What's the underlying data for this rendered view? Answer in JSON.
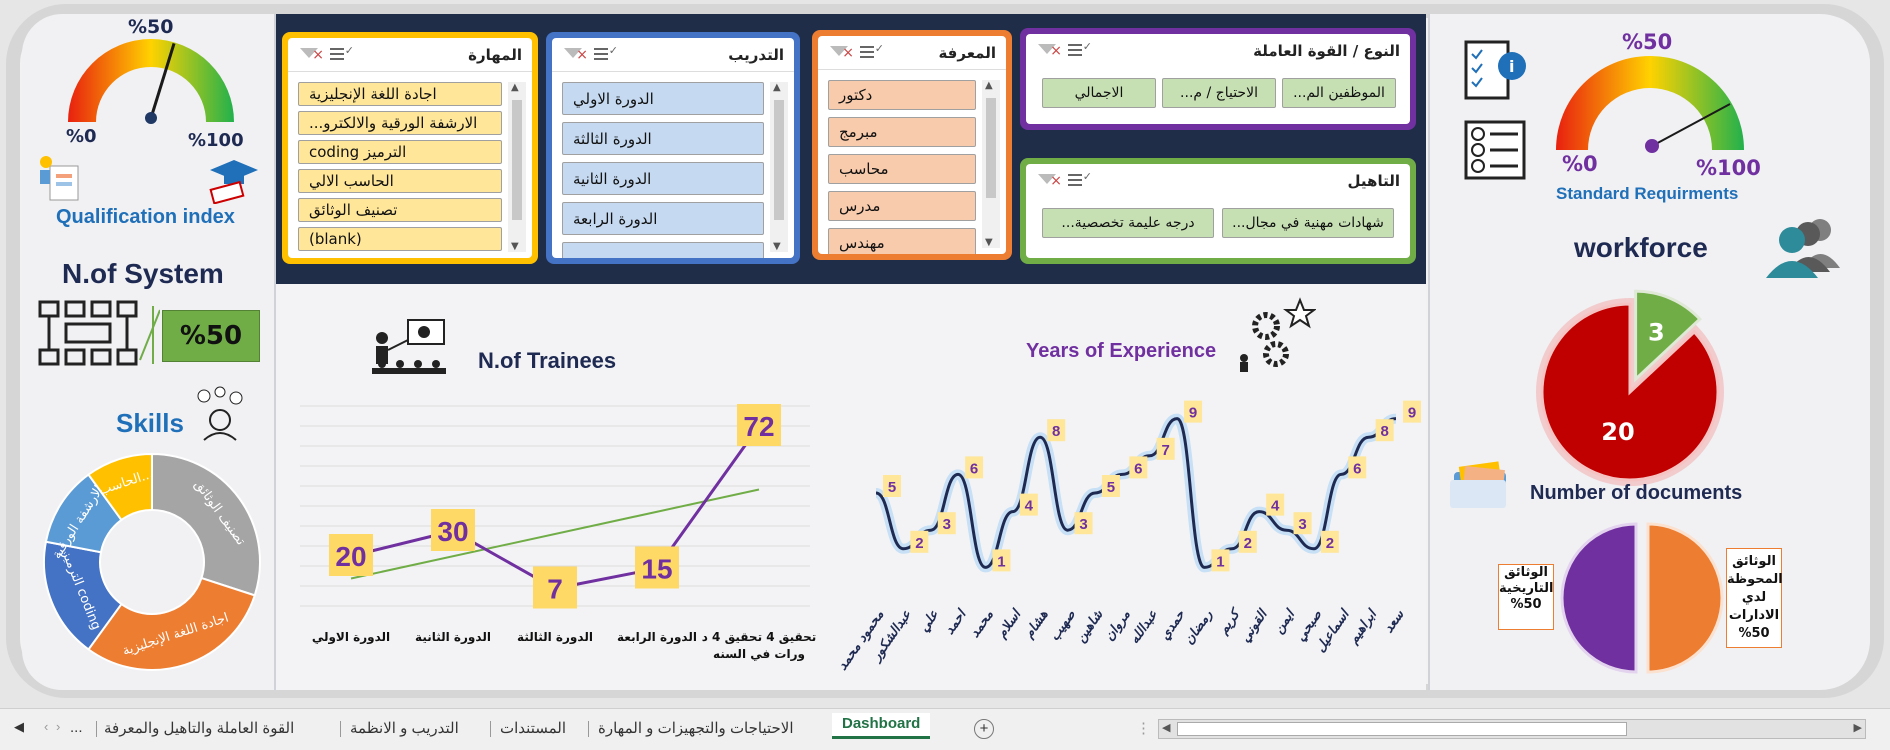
{
  "gauges": {
    "qualification": {
      "top_label": "%50",
      "min_label": "%0",
      "max_label": "%100",
      "value_pct": 50,
      "title": "Qualification index"
    },
    "standard": {
      "top_label": "%50",
      "min_label": "%0",
      "max_label": "%100",
      "value_pct": 70,
      "title": "Standard Requirments"
    }
  },
  "system": {
    "title": "N.of System",
    "value": "%50"
  },
  "skills": {
    "title": "Skills",
    "segments": [
      {
        "label": "تصنيف الوثائق",
        "value": 30,
        "color": "#a5a5a5"
      },
      {
        "label": "اجادة اللغة الإنجليزية",
        "value": 30,
        "color": "#ed7d31"
      },
      {
        "label": "الترميز coding",
        "value": 18,
        "color": "#4472c4"
      },
      {
        "label": "الارشفة الورقية...",
        "value": 12,
        "color": "#5b9bd5"
      },
      {
        "label": "الحاسب...",
        "value": 10,
        "color": "#ffc000"
      }
    ]
  },
  "slicers": {
    "skill": {
      "title": "المهارة",
      "items": [
        "اجادة اللغة الإنجليزية",
        "الارشفة الورقية والالكترو...",
        "coding الترميز",
        "الحاسب الالي",
        "تصنيف الوثائق",
        "(blank)"
      ]
    },
    "training": {
      "title": "التدريب",
      "items": [
        "الدورة الاولي",
        "الدورة الثالثة",
        "الدورة الثانية",
        "الدورة الرابعة",
        ""
      ]
    },
    "knowledge": {
      "title": "المعرفة",
      "items": [
        "دكتور",
        "مبرمج",
        "محاسب",
        "مدرس",
        "مهندس"
      ]
    },
    "workforce_type": {
      "title": "النوع / القوة العاملة",
      "items": [
        "الموظفين الم...",
        "الاحتياج / م...",
        "الاجمالي"
      ]
    },
    "qualification": {
      "title": "التاهيل",
      "items": [
        "شهادات مهنية في مجال...",
        "درجه عليمة تخصصية..."
      ]
    }
  },
  "trainees_chart": {
    "title": "N.of Trainees",
    "chart_data": {
      "type": "line",
      "categories": [
        "الدورة الاولي",
        "الدورة الثانية",
        "الدورة الثالثة",
        "الدورة الرابعة",
        "تحقيق 4 تحقيق 4 دورات في السنه"
      ],
      "series": [
        {
          "values": [
            20,
            30,
            7,
            15,
            72
          ]
        }
      ],
      "trendline": true,
      "ylim": [
        0,
        80
      ]
    }
  },
  "experience_chart": {
    "title": "Years of Experience",
    "chart_data": {
      "type": "line",
      "categories": [
        "محمود محمد",
        "عبدالشكور",
        "علي",
        "احمد",
        "محمد",
        "اسلام",
        "هشام",
        "صهيب",
        "شاهين",
        "مروان",
        "عبدالله",
        "حمدي",
        "رمضان",
        "كريم",
        "القوني",
        "ايمن",
        "صبحي",
        "اسماعيل",
        "ابراهيم",
        "سعد"
      ],
      "series": [
        {
          "values": [
            5,
            2,
            3,
            6,
            1,
            4,
            8,
            3,
            5,
            6,
            7,
            9,
            1,
            2,
            4,
            3,
            2,
            6,
            8,
            9
          ]
        }
      ],
      "ylim": [
        0,
        10
      ]
    }
  },
  "workforce": {
    "title": "workforce",
    "chart_data": {
      "type": "pie",
      "categories": [
        "",
        ""
      ],
      "values": [
        20,
        3
      ]
    }
  },
  "documents": {
    "title": "Number of documents",
    "chart_data": {
      "type": "pie",
      "categories": [
        "الوثائق التاريخية",
        "الوثائق المحوظة لدي الادارات"
      ],
      "values": [
        50,
        50
      ]
    },
    "left_label": [
      "الوثائق",
      "التاريخية",
      "%50"
    ],
    "right_label": [
      "الوثائق",
      "المحوظة",
      "لدي",
      "الادارات",
      "%50"
    ]
  },
  "tabs": {
    "items": [
      "القوة العاملة والتاهيل والمعرفة",
      "التدريب و الانظمة",
      "المستندات",
      "الاحتياجات والتجهيزات و المهارة"
    ],
    "active": "Dashboard",
    "more": "..."
  },
  "colors": {
    "navy": "#1f2d49",
    "purple": "#7030a0",
    "label_bg": "#ffd966",
    "red": "#c00000",
    "green": "#70ad47"
  }
}
